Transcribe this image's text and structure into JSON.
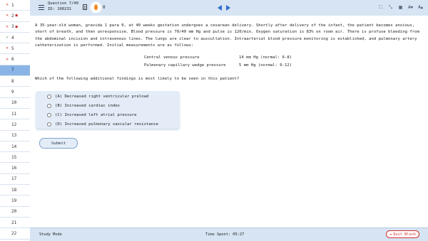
{
  "sidebar": {
    "items": [
      {
        "number": "1",
        "status": "wrong",
        "mark": "✕",
        "flagged": false
      },
      {
        "number": "2",
        "status": "wrong",
        "mark": "✕",
        "flagged": true
      },
      {
        "number": "3",
        "status": "wrong",
        "mark": "✕",
        "flagged": true
      },
      {
        "number": "4",
        "status": "correct",
        "mark": "✓",
        "flagged": false
      },
      {
        "number": "5",
        "status": "wrong",
        "mark": "✕",
        "flagged": false
      },
      {
        "number": "6",
        "status": "wrong",
        "mark": "✕",
        "flagged": false
      },
      {
        "number": "7",
        "status": "current",
        "mark": "",
        "flagged": false
      },
      {
        "number": "8"
      },
      {
        "number": "9"
      },
      {
        "number": "10"
      },
      {
        "number": "11"
      },
      {
        "number": "12"
      },
      {
        "number": "13"
      },
      {
        "number": "14"
      },
      {
        "number": "15"
      },
      {
        "number": "16"
      },
      {
        "number": "17"
      },
      {
        "number": "18"
      },
      {
        "number": "19"
      },
      {
        "number": "20"
      },
      {
        "number": "21"
      },
      {
        "number": "22"
      }
    ],
    "flag_glyph": "■",
    "colors": {
      "current": "#8ab4e6",
      "wrong": "#d32f2f",
      "correct": "#2e7d32",
      "flag": "#c62828"
    }
  },
  "header": {
    "question_label": "Question 7/40",
    "id_label": "ID: 100231",
    "streak_count": "0",
    "tool_icons": [
      "expand-icon",
      "collapse-icon",
      "calculator-icon",
      "font-decrease-icon",
      "font-increase-icon"
    ],
    "tool_glyphs": [
      "⛶",
      "⤡",
      "▦",
      "A▾",
      "A▴"
    ],
    "bar_color": "#d6e4f3",
    "nav_color": "#2f6fd0"
  },
  "question": {
    "stem": "A 35-year-old woman, gravida 1 para 0, at 40 weeks gestation undergoes a cesarean delivery.  Shortly after delivery of the infant, the patient becomes anxious, short of breath, and then unresponsive.  Blood pressure is 70/40 mm Hg and pulse is 120/min.  Oxygen saturation is 83% on room air.  There is profuse bleeding from the abdominal incision and intravenous lines.  The lungs are clear to auscultation.  Intraarterial blood pressure monitoring is established, and pulmonary artery catheterization is performed.  Initial measurements are as follows:",
    "labs": [
      {
        "name": "Central venous pressure",
        "value": "14 mm Hg (normal: 6-8)"
      },
      {
        "name": "Pulmonary capillary wedge pressure",
        "value": "5 mm Hg (normal: 6-12)"
      }
    ],
    "prompt": "Which of the following additional findings is most likely to be seen in this patient?",
    "choices": [
      {
        "label": "(A) Decreased right ventricular preload"
      },
      {
        "label": "(B) Increased cardiac index"
      },
      {
        "label": "(C) Increased left atrial pressure"
      },
      {
        "label": "(D) Increased pulmonary vascular resistance"
      }
    ],
    "submit_label": "Submit"
  },
  "footer": {
    "mode": "Study Mode",
    "time_spent": "Time Spent: 05:27",
    "quit_label": "Quit Block",
    "quit_icon": "⇥"
  }
}
